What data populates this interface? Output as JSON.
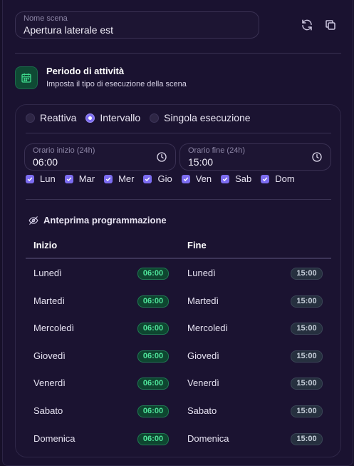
{
  "scene": {
    "label": "Nome scena",
    "value": "Apertura laterale est",
    "refresh_icon": "refresh-icon",
    "copy_icon": "copy-icon"
  },
  "section": {
    "icon": "calendar-icon",
    "title": "Periodo di attività",
    "subtitle": "Imposta il tipo di esecuzione della scena"
  },
  "mode": {
    "options": [
      "Reattiva",
      "Intervallo",
      "Singola esecuzione"
    ],
    "selected": "Intervallo"
  },
  "start_time": {
    "label": "Orario inizio (24h)",
    "value": "06:00",
    "icon": "clock-icon"
  },
  "end_time": {
    "label": "Orario fine (24h)",
    "value": "15:00",
    "icon": "clock-icon"
  },
  "days": [
    {
      "label": "Lun",
      "checked": true
    },
    {
      "label": "Mar",
      "checked": true
    },
    {
      "label": "Mer",
      "checked": true
    },
    {
      "label": "Gio",
      "checked": true
    },
    {
      "label": "Ven",
      "checked": true
    },
    {
      "label": "Sab",
      "checked": true
    },
    {
      "label": "Dom",
      "checked": true
    }
  ],
  "preview": {
    "icon": "eye-off-icon",
    "title": "Anteprima programmazione",
    "col_start": "Inizio",
    "col_end": "Fine",
    "rows": [
      {
        "start_day": "Lunedì",
        "start_time": "06:00",
        "end_day": "Lunedì",
        "end_time": "15:00"
      },
      {
        "start_day": "Martedì",
        "start_time": "06:00",
        "end_day": "Martedì",
        "end_time": "15:00"
      },
      {
        "start_day": "Mercoledì",
        "start_time": "06:00",
        "end_day": "Mercoledì",
        "end_time": "15:00"
      },
      {
        "start_day": "Giovedì",
        "start_time": "06:00",
        "end_day": "Giovedì",
        "end_time": "15:00"
      },
      {
        "start_day": "Venerdì",
        "start_time": "06:00",
        "end_day": "Venerdì",
        "end_time": "15:00"
      },
      {
        "start_day": "Sabato",
        "start_time": "06:00",
        "end_day": "Sabato",
        "end_time": "15:00"
      },
      {
        "start_day": "Domenica",
        "start_time": "06:00",
        "end_day": "Domenica",
        "end_time": "15:00"
      }
    ]
  },
  "colors": {
    "accent": "#7c6cf0",
    "start_badge": "#4fe39a",
    "end_badge": "#c9d1dc"
  }
}
